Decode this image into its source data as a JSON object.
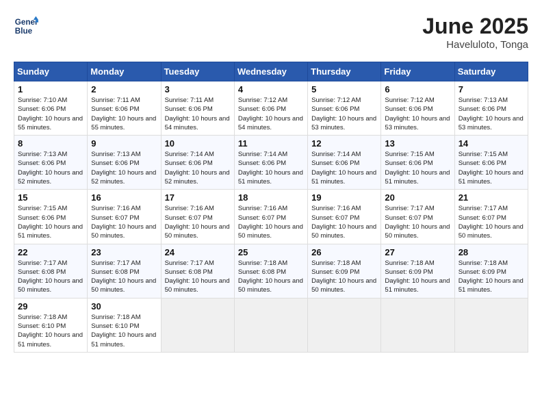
{
  "header": {
    "logo_line1": "General",
    "logo_line2": "Blue",
    "month": "June 2025",
    "location": "Haveluloto, Tonga"
  },
  "weekdays": [
    "Sunday",
    "Monday",
    "Tuesday",
    "Wednesday",
    "Thursday",
    "Friday",
    "Saturday"
  ],
  "weeks": [
    [
      {
        "day": "1",
        "sunrise": "7:10 AM",
        "sunset": "6:06 PM",
        "daylight": "10 hours and 55 minutes."
      },
      {
        "day": "2",
        "sunrise": "7:11 AM",
        "sunset": "6:06 PM",
        "daylight": "10 hours and 55 minutes."
      },
      {
        "day": "3",
        "sunrise": "7:11 AM",
        "sunset": "6:06 PM",
        "daylight": "10 hours and 54 minutes."
      },
      {
        "day": "4",
        "sunrise": "7:12 AM",
        "sunset": "6:06 PM",
        "daylight": "10 hours and 54 minutes."
      },
      {
        "day": "5",
        "sunrise": "7:12 AM",
        "sunset": "6:06 PM",
        "daylight": "10 hours and 53 minutes."
      },
      {
        "day": "6",
        "sunrise": "7:12 AM",
        "sunset": "6:06 PM",
        "daylight": "10 hours and 53 minutes."
      },
      {
        "day": "7",
        "sunrise": "7:13 AM",
        "sunset": "6:06 PM",
        "daylight": "10 hours and 53 minutes."
      }
    ],
    [
      {
        "day": "8",
        "sunrise": "7:13 AM",
        "sunset": "6:06 PM",
        "daylight": "10 hours and 52 minutes."
      },
      {
        "day": "9",
        "sunrise": "7:13 AM",
        "sunset": "6:06 PM",
        "daylight": "10 hours and 52 minutes."
      },
      {
        "day": "10",
        "sunrise": "7:14 AM",
        "sunset": "6:06 PM",
        "daylight": "10 hours and 52 minutes."
      },
      {
        "day": "11",
        "sunrise": "7:14 AM",
        "sunset": "6:06 PM",
        "daylight": "10 hours and 51 minutes."
      },
      {
        "day": "12",
        "sunrise": "7:14 AM",
        "sunset": "6:06 PM",
        "daylight": "10 hours and 51 minutes."
      },
      {
        "day": "13",
        "sunrise": "7:15 AM",
        "sunset": "6:06 PM",
        "daylight": "10 hours and 51 minutes."
      },
      {
        "day": "14",
        "sunrise": "7:15 AM",
        "sunset": "6:06 PM",
        "daylight": "10 hours and 51 minutes."
      }
    ],
    [
      {
        "day": "15",
        "sunrise": "7:15 AM",
        "sunset": "6:06 PM",
        "daylight": "10 hours and 51 minutes."
      },
      {
        "day": "16",
        "sunrise": "7:16 AM",
        "sunset": "6:07 PM",
        "daylight": "10 hours and 50 minutes."
      },
      {
        "day": "17",
        "sunrise": "7:16 AM",
        "sunset": "6:07 PM",
        "daylight": "10 hours and 50 minutes."
      },
      {
        "day": "18",
        "sunrise": "7:16 AM",
        "sunset": "6:07 PM",
        "daylight": "10 hours and 50 minutes."
      },
      {
        "day": "19",
        "sunrise": "7:16 AM",
        "sunset": "6:07 PM",
        "daylight": "10 hours and 50 minutes."
      },
      {
        "day": "20",
        "sunrise": "7:17 AM",
        "sunset": "6:07 PM",
        "daylight": "10 hours and 50 minutes."
      },
      {
        "day": "21",
        "sunrise": "7:17 AM",
        "sunset": "6:07 PM",
        "daylight": "10 hours and 50 minutes."
      }
    ],
    [
      {
        "day": "22",
        "sunrise": "7:17 AM",
        "sunset": "6:08 PM",
        "daylight": "10 hours and 50 minutes."
      },
      {
        "day": "23",
        "sunrise": "7:17 AM",
        "sunset": "6:08 PM",
        "daylight": "10 hours and 50 minutes."
      },
      {
        "day": "24",
        "sunrise": "7:17 AM",
        "sunset": "6:08 PM",
        "daylight": "10 hours and 50 minutes."
      },
      {
        "day": "25",
        "sunrise": "7:18 AM",
        "sunset": "6:08 PM",
        "daylight": "10 hours and 50 minutes."
      },
      {
        "day": "26",
        "sunrise": "7:18 AM",
        "sunset": "6:09 PM",
        "daylight": "10 hours and 50 minutes."
      },
      {
        "day": "27",
        "sunrise": "7:18 AM",
        "sunset": "6:09 PM",
        "daylight": "10 hours and 51 minutes."
      },
      {
        "day": "28",
        "sunrise": "7:18 AM",
        "sunset": "6:09 PM",
        "daylight": "10 hours and 51 minutes."
      }
    ],
    [
      {
        "day": "29",
        "sunrise": "7:18 AM",
        "sunset": "6:10 PM",
        "daylight": "10 hours and 51 minutes."
      },
      {
        "day": "30",
        "sunrise": "7:18 AM",
        "sunset": "6:10 PM",
        "daylight": "10 hours and 51 minutes."
      },
      null,
      null,
      null,
      null,
      null
    ]
  ]
}
